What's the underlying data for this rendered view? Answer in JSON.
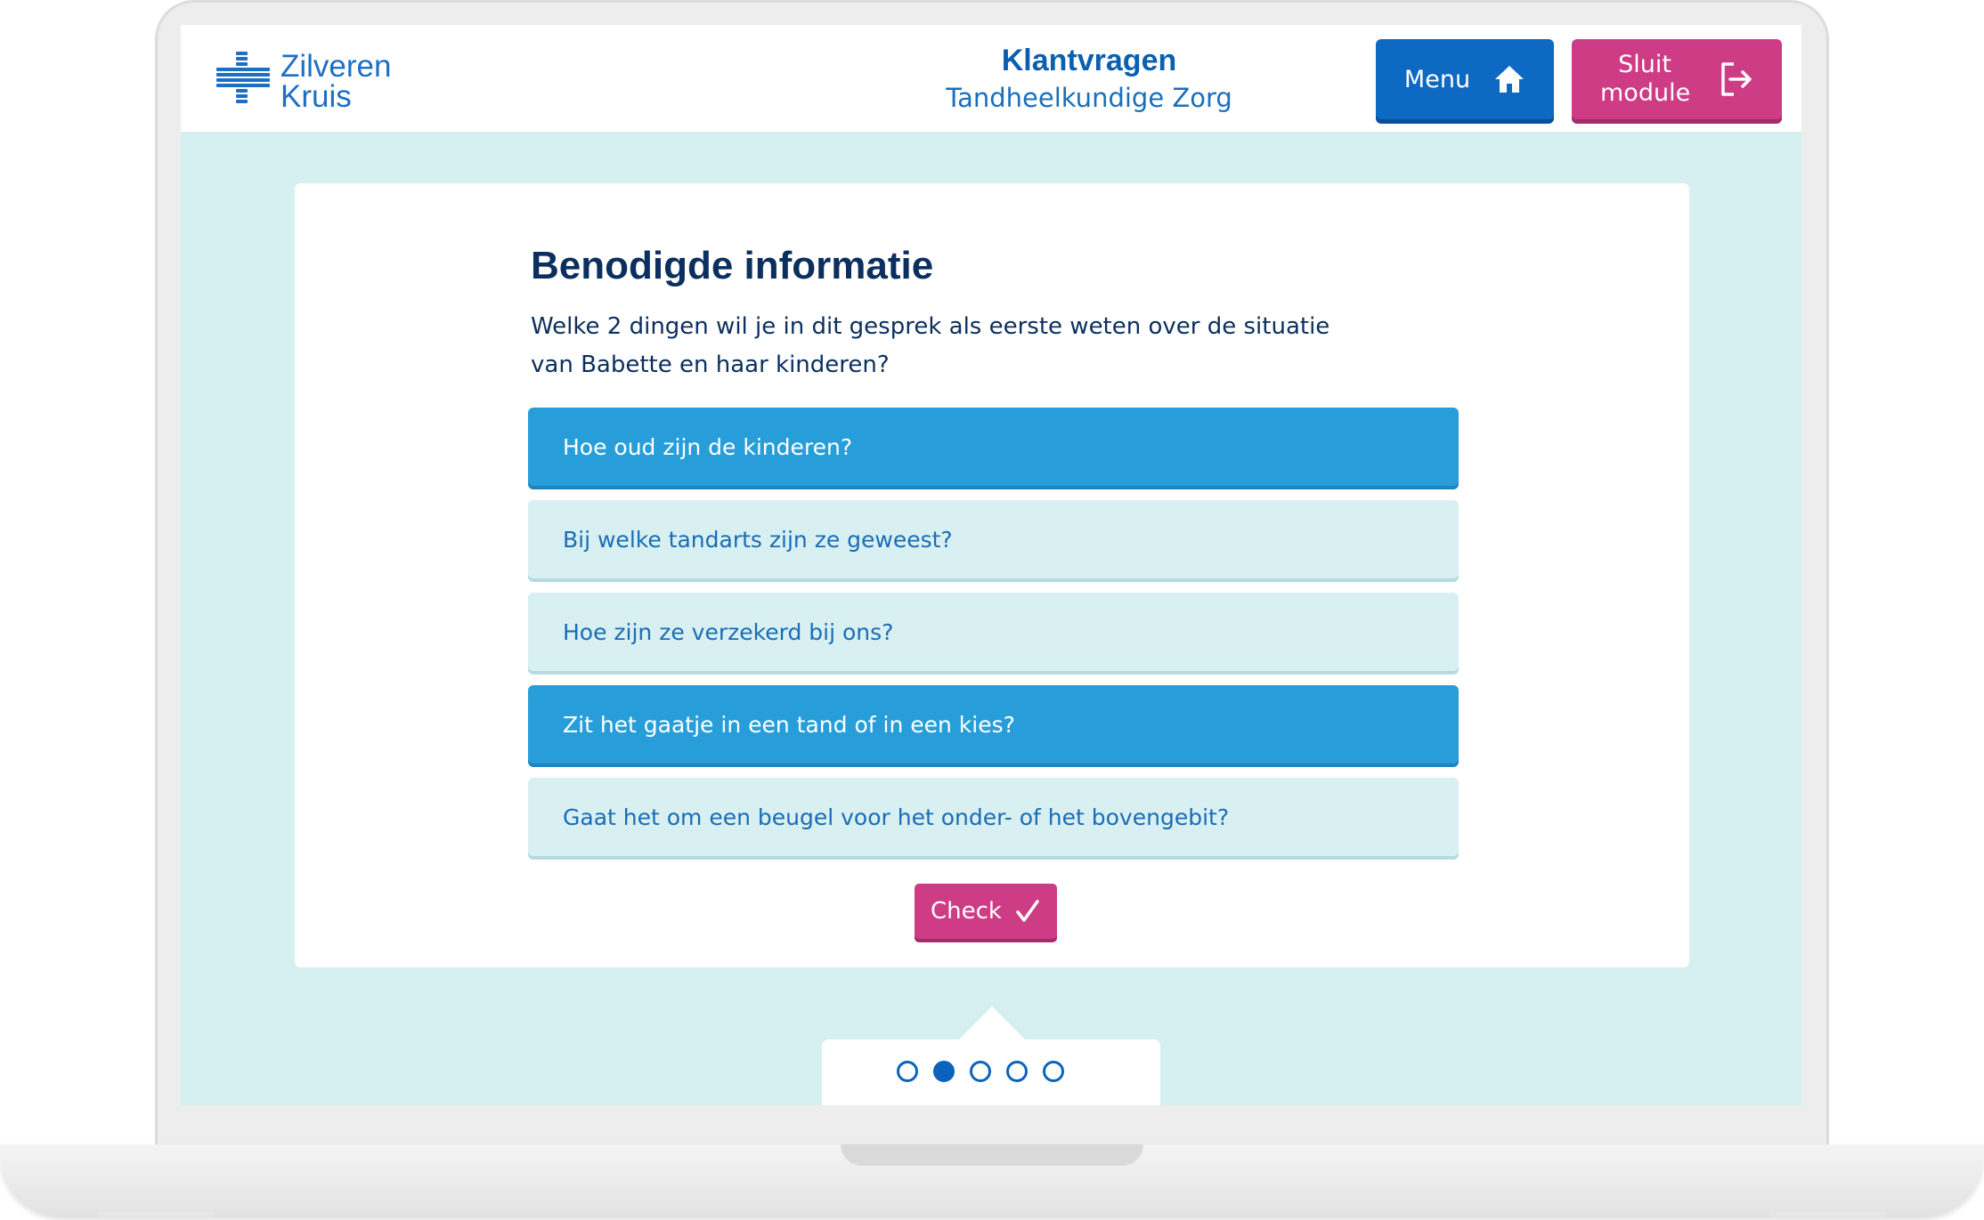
{
  "header": {
    "logo": {
      "line1": "Zilveren",
      "line2": "Kruis"
    },
    "title": "Klantvragen",
    "subtitle": "Tandheelkundige Zorg",
    "menu_label": "Menu",
    "close_line1": "Sluit",
    "close_line2": "module"
  },
  "question": {
    "title": "Benodigde informatie",
    "text": "Welke 2 dingen wil je in dit gesprek als eerste weten over de situatie van Babette en haar kinderen?",
    "options": [
      {
        "label": "Hoe oud zijn de kinderen?",
        "selected": true
      },
      {
        "label": "Bij welke tandarts zijn ze geweest?",
        "selected": false
      },
      {
        "label": "Hoe zijn ze verzekerd bij ons?",
        "selected": false
      },
      {
        "label": "Zit het gaatje in een tand of in een kies?",
        "selected": true
      },
      {
        "label": "Gaat het om een beugel voor het onder- of het bovengebit?",
        "selected": false
      }
    ],
    "check_label": "Check"
  },
  "pagination": {
    "total": 5,
    "current": 2
  },
  "colors": {
    "brand_blue": "#0e69c3",
    "selected_option": "#279ed9",
    "accent_pink": "#ce3c86",
    "background": "#d6eff0"
  },
  "icons": {
    "logo": "cross-logo-icon",
    "menu": "home-icon",
    "close": "exit-icon",
    "check": "checkmark-icon"
  }
}
